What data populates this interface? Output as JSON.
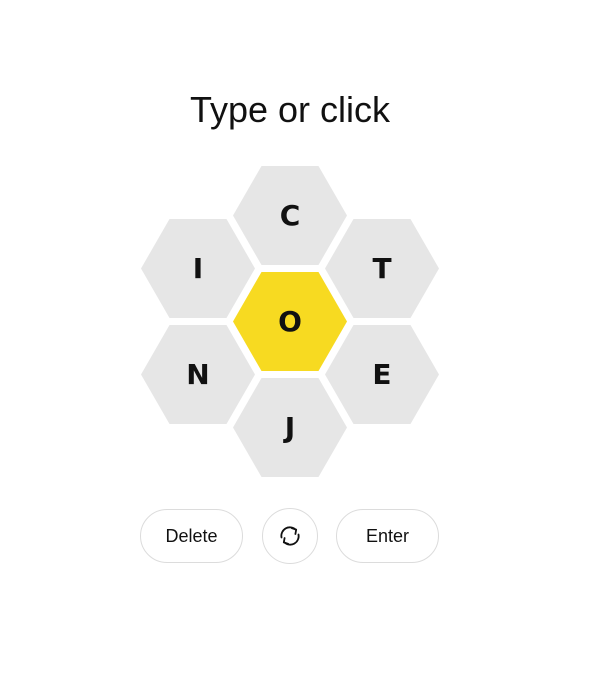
{
  "prompt": "Type or click",
  "hive": {
    "center_letter": "O",
    "outer_letters": {
      "top": "C",
      "upper_left": "I",
      "upper_right": "T",
      "lower_left": "N",
      "lower_right": "E",
      "bottom": "J"
    }
  },
  "controls": {
    "delete_label": "Delete",
    "shuffle_icon": "shuffle-icon",
    "enter_label": "Enter"
  },
  "colors": {
    "center_cell": "#f7da21",
    "outer_cell": "#e6e6e6",
    "text": "#111111",
    "button_border": "#dcdcdc"
  }
}
